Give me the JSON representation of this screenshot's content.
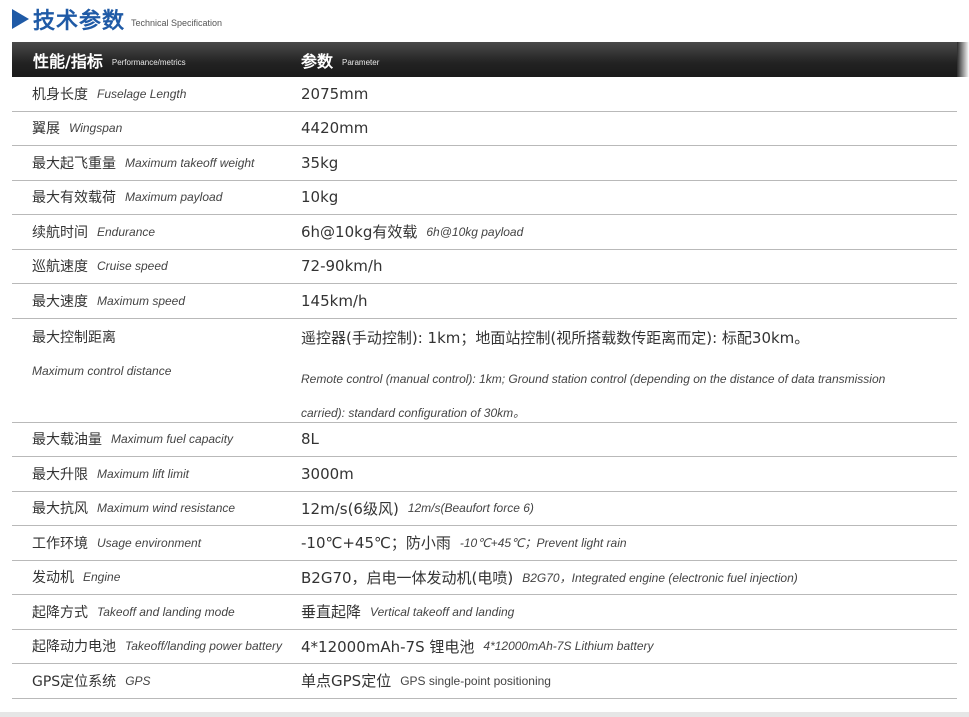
{
  "header": {
    "title_cn": "技术参数",
    "title_en": "Technical Specification"
  },
  "table": {
    "columns": [
      {
        "cn": "性能/指标",
        "en": "Performance/metrics"
      },
      {
        "cn": "参数",
        "en": "Parameter"
      }
    ],
    "rows": [
      {
        "cn": "机身长度",
        "en": "Fuselage Length",
        "value": "2075mm",
        "value_en": ""
      },
      {
        "cn": "翼展",
        "en": "Wingspan",
        "value": "4420mm",
        "value_en": ""
      },
      {
        "cn": "最大起飞重量",
        "en": "Maximum takeoff weight",
        "value": "35kg",
        "value_en": ""
      },
      {
        "cn": "最大有效载荷",
        "en": "Maximum payload",
        "value": "10kg",
        "value_en": ""
      },
      {
        "cn": "续航时间",
        "en": "Endurance",
        "value": "6h@10kg有效载",
        "value_en": "6h@10kg payload"
      },
      {
        "cn": "巡航速度",
        "en": "Cruise speed",
        "value": "72-90km/h",
        "value_en": ""
      },
      {
        "cn": "最大速度",
        "en": "Maximum speed",
        "value": "145km/h",
        "value_en": ""
      },
      {
        "cn": "最大控制距离",
        "en": "Maximum control distance",
        "value": "遥控器(手动控制): 1km；地面站控制(视所搭载数传距离而定): 标配30km。",
        "value_en": "Remote control (manual control): 1km; Ground station control (depending on the distance of data transmission carried): standard configuration of 30km。"
      },
      {
        "cn": "最大载油量",
        "en": "Maximum fuel capacity",
        "value": "8L",
        "value_en": ""
      },
      {
        "cn": "最大升限",
        "en": "Maximum lift limit",
        "value": "3000m",
        "value_en": ""
      },
      {
        "cn": "最大抗风",
        "en": "Maximum wind resistance",
        "value": "12m/s(6级风)",
        "value_en": "12m/s(Beaufort force 6)"
      },
      {
        "cn": "工作环境",
        "en": "Usage environment",
        "value": "-10℃+45℃；防小雨",
        "value_en": "-10℃+45℃；Prevent light rain"
      },
      {
        "cn": "发动机",
        "en": "Engine",
        "value": "B2G70，启电一体发动机(电喷)",
        "value_en": "B2G70，Integrated engine (electronic fuel injection)"
      },
      {
        "cn": "起降方式",
        "en": "Takeoff and landing mode",
        "value": "垂直起降",
        "value_en": "Vertical takeoff and landing"
      },
      {
        "cn": "起降动力电池",
        "en": "Takeoff/landing power battery",
        "value": "4*12000mAh-7S 锂电池",
        "value_en": "4*12000mAh-7S Lithium battery"
      },
      {
        "cn": "GPS定位系统",
        "en": "GPS",
        "value": "单点GPS定位",
        "value_en": "GPS single-point positioning"
      }
    ]
  }
}
